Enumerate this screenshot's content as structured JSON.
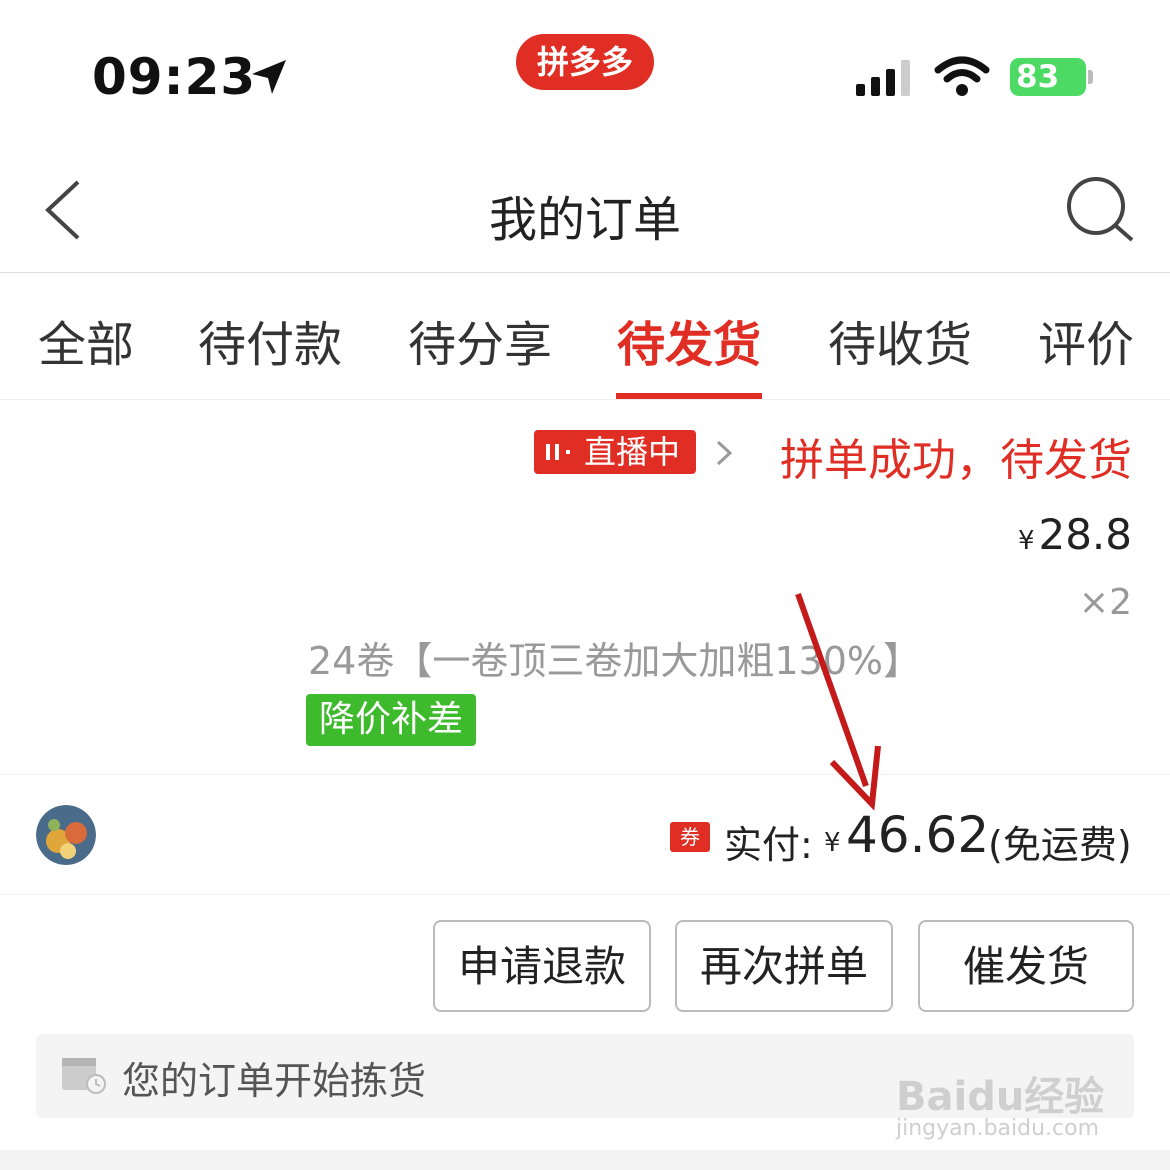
{
  "status_bar": {
    "time": "09:23",
    "battery": "83",
    "app_logo": "拼多多"
  },
  "nav": {
    "title": "我的订单"
  },
  "tabs": [
    {
      "label": "全部",
      "active": false
    },
    {
      "label": "待付款",
      "active": false
    },
    {
      "label": "待分享",
      "active": false
    },
    {
      "label": "待发货",
      "active": true
    },
    {
      "label": "待收货",
      "active": false
    },
    {
      "label": "评价",
      "active": false
    }
  ],
  "order": {
    "live_badge": "直播中",
    "status": "拼单成功，待发货",
    "price_symbol": "¥",
    "price": "28.8",
    "quantity": "×2",
    "product_title": "24卷【一卷顶三卷加大加粗130%】",
    "tag": "降价补差",
    "coupon_icon": "券",
    "paid_label": "实付:",
    "paid_symbol": "¥",
    "paid_amount": "46.62",
    "paid_note": "(免运费)"
  },
  "actions": {
    "refund": "申请退款",
    "reorder": "再次拼单",
    "urge": "催发货"
  },
  "logistics": {
    "text": "您的订单开始拣货"
  },
  "watermark": {
    "main": "Baidu经验",
    "sub": "jingyan.baidu.com"
  },
  "colors": {
    "brand_red": "#e02e24",
    "tag_green": "#3dbb2d",
    "battery_green": "#4cd964"
  }
}
